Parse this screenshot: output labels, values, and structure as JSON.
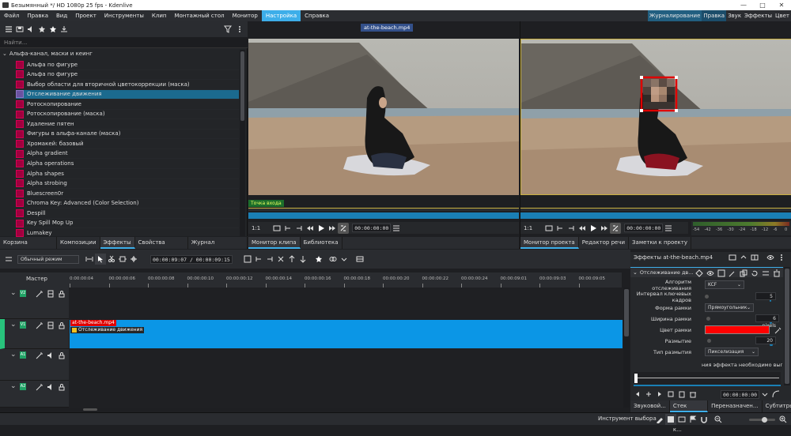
{
  "window": {
    "title": "Безымянный */ HD 1080p 25 fps - Kdenlive"
  },
  "menu": {
    "items": [
      "Файл",
      "Правка",
      "Вид",
      "Проект",
      "Инструменты",
      "Клип",
      "Монтажный стол",
      "Монитор",
      "Настройка",
      "Справка"
    ],
    "active_index": 8
  },
  "workspaces": {
    "items": [
      "Журналирование",
      "Правка",
      "Звук",
      "Эффекты",
      "Цвет"
    ],
    "active_index": 1
  },
  "effects": {
    "search_placeholder": "Найти...",
    "category": "Альфа-канал, маски и кеинг",
    "items": [
      "Альфа по фигуре",
      "Альфа по фигуре",
      "Выбор области для вторичной цветокоррекции (маска)",
      "Отслеживание движения",
      "Ротоскопирование",
      "Ротоскопирование (маска)",
      "Удаление пятен",
      "Фигуры в альфа-канале (маска)",
      "Хромакей: базовый",
      "Alpha gradient",
      "Alpha operations",
      "Alpha shapes",
      "Alpha strobing",
      "Bluescreen0r",
      "Chroma Key: Advanced (Color Selection)",
      "Despill",
      "Key Spill Mop Up",
      "Lumakey"
    ],
    "selected_index": 3
  },
  "left_tabs": {
    "items": [
      "Корзина проекта",
      "Композиции",
      "Эффекты",
      "Свойства клипа",
      "Журнал действий"
    ],
    "active_index": 2
  },
  "clip_monitor": {
    "clip_name": "at-the-beach.mp4",
    "in_point_label": "Точка входа",
    "zoom": "1:1",
    "timecode": "00:00:00:00",
    "tabs": [
      "Монитор клипа",
      "Библиотека"
    ],
    "active_tab": 0
  },
  "project_monitor": {
    "zoom": "1:1",
    "timecode": "00:00:00:00",
    "audio_scale": [
      "-54",
      "-42",
      "-36",
      "-30",
      "-24",
      "-18",
      "-12",
      "-6",
      "0"
    ],
    "tabs": [
      "Монитор проекта",
      "Редактор речи",
      "Заметки к проекту"
    ],
    "active_tab": 0
  },
  "timeline": {
    "mode": "Обычный режим",
    "position": "00:00:09:07",
    "duration": "00:00:09:15",
    "master": "Мастер",
    "ruler": [
      "0:00:00:04",
      "00:00:00:06",
      "00:00:00:08",
      "00:00:00:10",
      "00:00:00:12",
      "00:00:00:14",
      "00:00:00:16",
      "00:00:00:18",
      "00:00:00:20",
      "00:00:00:22",
      "00:00:00:24",
      "00:00:09:01",
      "00:00:09:03",
      "00:00:09:05"
    ],
    "tracks": [
      {
        "name": "V2",
        "type": "video"
      },
      {
        "name": "V1",
        "type": "video"
      },
      {
        "name": "A1",
        "type": "audio"
      },
      {
        "name": "A2",
        "type": "audio"
      }
    ],
    "clip": {
      "name": "at-the-beach.mp4",
      "effect": "Отслеживание движения"
    }
  },
  "effect_stack": {
    "title": "Эффекты at-the-beach.mp4",
    "effect_name": "Отслеживание дв...",
    "params": {
      "algorithm_label": "Алгоритм отслеживания",
      "algorithm": "KCF",
      "keyframe_interval_label": "Интервал ключевых кадров",
      "keyframe_interval": "5",
      "shape_label": "Форма рамки",
      "shape": "Прямоугольник",
      "frame_width_label": "Ширина рамки",
      "frame_width": "6 pixels",
      "frame_color_label": "Цвет рамки",
      "frame_color": "#ff0000",
      "blur_label": "Размытие",
      "blur": "20",
      "blur_type_label": "Тип размытия",
      "blur_type": "Пикселизация",
      "message": "ния эффекта необходимо выполни"
    },
    "timecode": "00:00:00:00"
  },
  "right_tabs": {
    "items": [
      "Звуковой...",
      "Стек эффектов/к...",
      "Переназначен...",
      "Субтитры"
    ],
    "active_index": 1
  },
  "status": {
    "tool": "Инструмент выбора"
  },
  "colors": {
    "accent": "#3daee9",
    "clip": "#0b96e6",
    "selection_red": "#e00000",
    "track_video": "#21a366",
    "track_active": "#28c37c"
  }
}
